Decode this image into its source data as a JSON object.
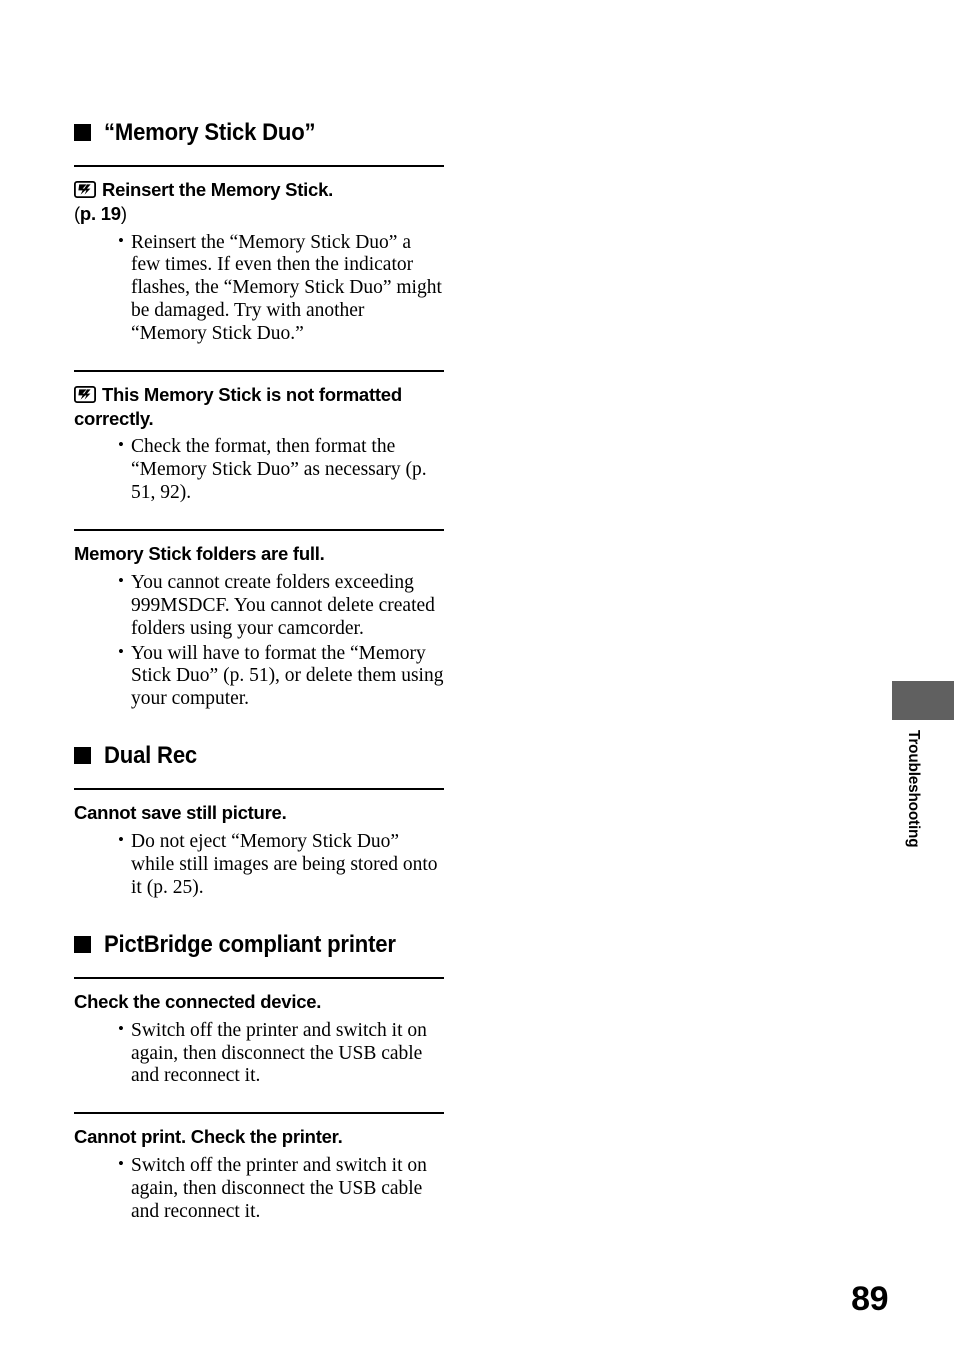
{
  "page": {
    "number": "89",
    "side_tab_label": "Troubleshooting",
    "side_tab_color": "#606060"
  },
  "sections": [
    {
      "title": "“Memory Stick Duo”",
      "marker_icon": "black-square-bullet",
      "entries": [
        {
          "icon": "memory-stick-icon",
          "heading": "Reinsert the Memory Stick.",
          "heading_page_ref_open": "(",
          "heading_page_ref": "p. 19",
          "heading_page_ref_close": ")",
          "bullets": [
            "Reinsert the “Memory Stick Duo” a few times. If even then the indicator flashes, the “Memory Stick Duo” might be damaged. Try with another “Memory Stick Duo.”"
          ]
        },
        {
          "icon": "memory-stick-icon",
          "heading": "This Memory Stick is not formatted correctly.",
          "bullets": [
            "Check the format, then format the “Memory Stick Duo” as necessary (p. 51, 92)."
          ]
        },
        {
          "icon": null,
          "heading": "Memory Stick folders are full.",
          "bullets": [
            "You cannot create folders exceeding 999MSDCF. You cannot delete created folders using your camcorder.",
            "You will have to format the “Memory Stick Duo” (p. 51), or delete them using your computer."
          ]
        }
      ]
    },
    {
      "title": "Dual Rec",
      "marker_icon": "black-square-bullet",
      "entries": [
        {
          "icon": null,
          "heading": "Cannot save still picture.",
          "bullets": [
            "Do not eject “Memory Stick Duo” while still images are being stored onto it (p. 25)."
          ]
        }
      ]
    },
    {
      "title": "PictBridge compliant printer",
      "marker_icon": "black-square-bullet",
      "entries": [
        {
          "icon": null,
          "heading": "Check the connected device.",
          "bullets": [
            "Switch off the printer and switch it on again, then disconnect the USB cable and reconnect it."
          ]
        },
        {
          "icon": null,
          "heading": "Cannot print. Check the printer.",
          "bullets": [
            "Switch off the printer and switch it on again, then disconnect the USB cable and reconnect it."
          ]
        }
      ]
    }
  ]
}
